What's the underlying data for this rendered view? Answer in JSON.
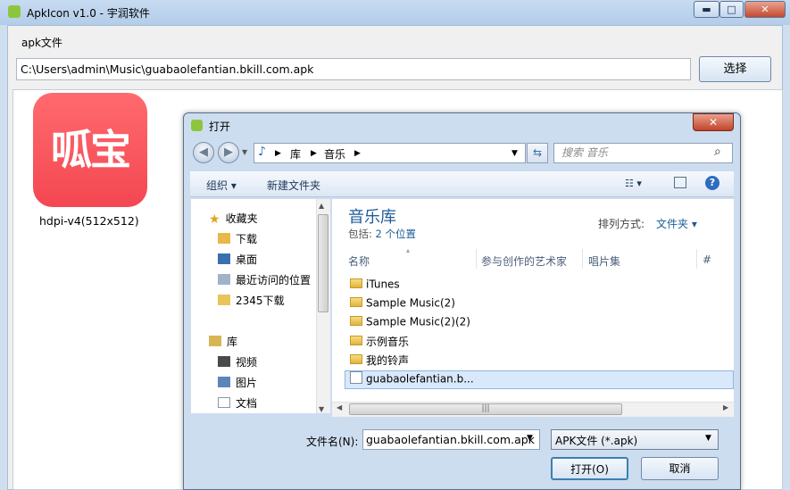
{
  "window": {
    "title": "ApkIcon v1.0 - 宇润软件",
    "minimize_glyph": "▬",
    "maximize_glyph": "□",
    "close_glyph": "✕"
  },
  "apk_section": {
    "label": "apk文件",
    "path_value": "C:\\Users\\admin\\Music\\guabaolefantian.bkill.com.apk",
    "select_button": "选择"
  },
  "preview": {
    "icon_text": "呱宝",
    "icon_color": "#f44752",
    "caption": "hdpi-v4(512x512)"
  },
  "dialog": {
    "title": "打开",
    "close_glyph": "✕",
    "address": {
      "crumbs": [
        "库",
        "音乐"
      ]
    },
    "search_placeholder": "搜索 音乐",
    "toolbar": {
      "organize": "组织 ▾",
      "new_folder": "新建文件夹"
    },
    "nav": {
      "favorites": "收藏夹",
      "items": [
        "下载",
        "桌面",
        "最近访问的位置",
        "2345下载"
      ],
      "library": "库",
      "library_items": [
        "视频",
        "图片",
        "文档"
      ]
    },
    "library": {
      "title": "音乐库",
      "includes_label": "包括: ",
      "includes_locations": "2 个位置",
      "sort_label": "排列方式:",
      "sort_value": "文件夹 ▾"
    },
    "columns": [
      "名称",
      "参与创作的艺术家",
      "唱片集",
      "#"
    ],
    "files": [
      {
        "name": "iTunes",
        "type": "folder"
      },
      {
        "name": "Sample Music(2)",
        "type": "folder"
      },
      {
        "name": "Sample Music(2)(2)",
        "type": "folder"
      },
      {
        "name": "示例音乐",
        "type": "folder"
      },
      {
        "name": "我的铃声",
        "type": "folder"
      },
      {
        "name": "guabaolefantian.b...",
        "type": "apk"
      }
    ],
    "filename_label": "文件名(N):",
    "filename_value": "guabaolefantian.bkill.com.apk",
    "filter_value": "APK文件 (*.apk)",
    "open_button": "打开(O)",
    "cancel_button": "取消"
  }
}
